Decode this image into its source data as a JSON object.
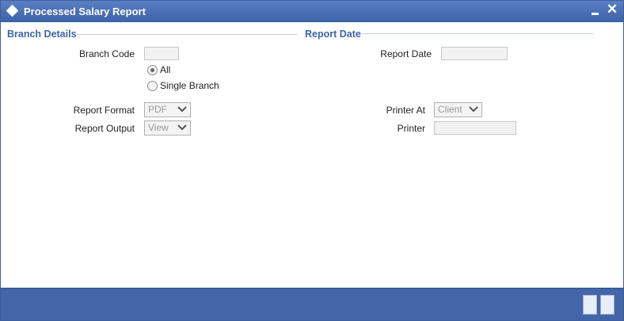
{
  "window": {
    "title": "Processed Salary Report"
  },
  "branch_details": {
    "heading": "Branch Details",
    "branch_code_label": "Branch Code",
    "branch_code_value": "",
    "options": [
      {
        "label": "All",
        "checked": true
      },
      {
        "label": "Single Branch",
        "checked": false
      }
    ],
    "report_format_label": "Report Format",
    "report_format_value": "PDF",
    "report_output_label": "Report Output",
    "report_output_value": "View"
  },
  "report_date": {
    "heading": "Report Date",
    "report_date_label": "Report Date",
    "report_date_value": "",
    "printer_at_label": "Printer At",
    "printer_at_value": "Client",
    "printer_label": "Printer",
    "printer_value": ""
  },
  "colors": {
    "title_bar": "#4a6fb5",
    "section_heading": "#3e64a8",
    "footer": "#4466a8"
  }
}
